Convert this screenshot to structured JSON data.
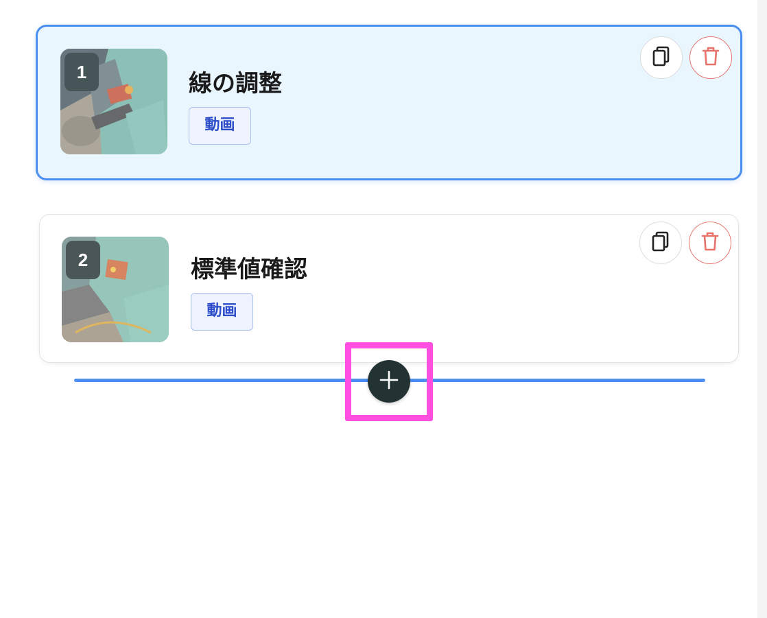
{
  "steps": [
    {
      "number": "1",
      "title": "線の調整",
      "type_label": "動画",
      "selected": true,
      "thumbnail_icon": "machine-photo-thumbnail"
    },
    {
      "number": "2",
      "title": "標準値確認",
      "type_label": "動画",
      "selected": false,
      "thumbnail_icon": "machine-photo-thumbnail"
    }
  ],
  "actions": {
    "copy_icon": "copy-icon",
    "delete_icon": "trash-icon",
    "add_icon": "plus-icon"
  },
  "colors": {
    "accent": "#4a8ef0",
    "selected_background": "#e9f6fe",
    "delete": "#e8736a",
    "tag_text": "#2c4cc9",
    "dark": "#233233",
    "highlight": "#ff4fe0"
  }
}
